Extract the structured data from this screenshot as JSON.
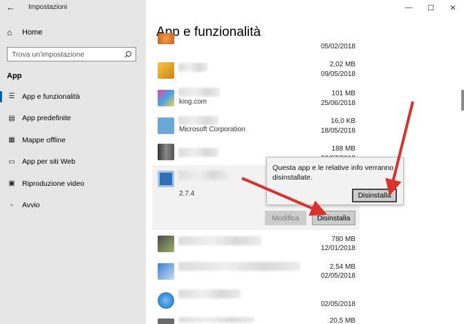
{
  "window": {
    "title": "Impostazioni",
    "back_icon": "back-arrow-icon",
    "controls": [
      "minimize-icon",
      "maximize-icon",
      "close-icon"
    ]
  },
  "sidebar": {
    "home_label": "Home",
    "search_placeholder": "Trova un'impostazione",
    "section": "App",
    "items": [
      {
        "label": "App e funzionalità",
        "icon": "list-icon",
        "active": true
      },
      {
        "label": "App predefinite",
        "icon": "default-apps-icon",
        "active": false
      },
      {
        "label": "Mappe offline",
        "icon": "map-icon",
        "active": false
      },
      {
        "label": "App per siti Web",
        "icon": "website-icon",
        "active": false
      },
      {
        "label": "Riproduzione video",
        "icon": "video-icon",
        "active": false
      },
      {
        "label": "Avvio",
        "icon": "startup-icon",
        "active": false
      }
    ]
  },
  "main": {
    "title": "App e funzionalità",
    "apps": [
      {
        "icon": "app-icon-orange",
        "size": "",
        "date": "05/02/2018",
        "publisher": ""
      },
      {
        "icon": "app-icon-box",
        "size": "2,02 MB",
        "date": "09/05/2018",
        "publisher": ""
      },
      {
        "icon": "app-icon-candy",
        "size": "101 MB",
        "date": "25/06/2018",
        "publisher": "king.com"
      },
      {
        "icon": "app-icon-calculator",
        "size": "16,0 KB",
        "date": "18/05/2018",
        "publisher": "Microsoft Corporation"
      },
      {
        "icon": "app-icon-phone",
        "size": "188 MB",
        "date": "06/07/2018",
        "publisher": ""
      },
      {
        "icon": "app-icon-display",
        "size": "",
        "date": "",
        "publisher": "2.7.4"
      },
      {
        "icon": "app-icon-chip",
        "size": "780 MB",
        "date": "12/01/2018",
        "publisher": ""
      },
      {
        "icon": "app-icon-drive",
        "size": "2,54 MB",
        "date": "02/05/2018",
        "publisher": ""
      },
      {
        "icon": "app-icon-globe",
        "size": "",
        "date": "02/05/2018",
        "publisher": ""
      },
      {
        "icon": "app-icon-device",
        "size": "20,5 MB",
        "date": "",
        "publisher": ""
      }
    ],
    "modify_label": "Modifica",
    "uninstall_label": "Disinstalla"
  },
  "popup": {
    "text": "Questa app e le relative info verranno disinstallate.",
    "button": "Disinstalla"
  },
  "annotation_color": "#d9322b"
}
